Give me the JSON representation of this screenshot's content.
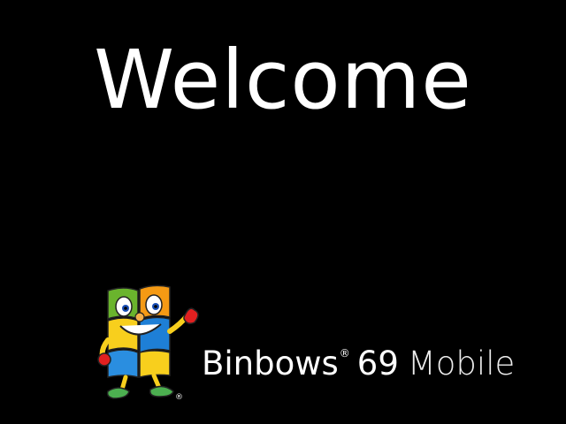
{
  "screen": {
    "title": "Welcome"
  },
  "brand": {
    "name": "Binbows",
    "registered": "®",
    "version": "69",
    "edition": "Mobile"
  },
  "mascot": {
    "icon": "binbows-mascot-logo-icon",
    "registered": "®"
  },
  "colors": {
    "background": "#000000",
    "text": "#ffffff",
    "logo_green": "#6ab42d",
    "logo_orange": "#f59a14",
    "logo_blue": "#1e7fd6",
    "logo_yellow": "#f8cf1d"
  }
}
